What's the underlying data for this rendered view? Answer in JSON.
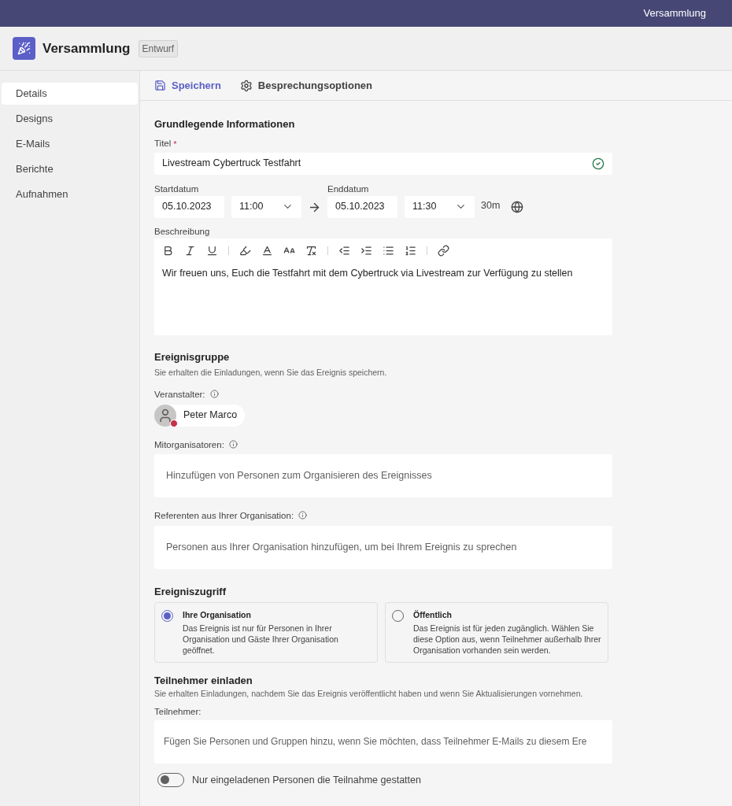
{
  "top_bar": {
    "title": "Versammlung"
  },
  "header": {
    "title": "Versammlung",
    "badge": "Entwurf"
  },
  "sidebar": {
    "items": [
      {
        "label": "Details",
        "selected": true
      },
      {
        "label": "Designs",
        "selected": false
      },
      {
        "label": "E-Mails",
        "selected": false
      },
      {
        "label": "Berichte",
        "selected": false
      },
      {
        "label": "Aufnahmen",
        "selected": false
      }
    ]
  },
  "toolbar": {
    "buttons": [
      {
        "label": "Speichern",
        "kind": "save"
      },
      {
        "label": "Besprechungsoptionen",
        "kind": "options"
      }
    ]
  },
  "basic": {
    "heading": "Grundlegende Informationen",
    "title_label": "Titel",
    "required_mark": "*",
    "title_value": "Livestream Cybertruck Testfahrt",
    "start_label": "Startdatum",
    "start_date": "05.10.2023",
    "start_time": "11:00",
    "end_label": "Enddatum",
    "end_date": "05.10.2023",
    "end_time": "11:30",
    "duration": "30m",
    "description_label": "Beschreibung",
    "description": "Wir freuen uns, Euch die Testfahrt mit dem Cybertruck via Livestream zur Verfügung zu stellen"
  },
  "group": {
    "heading": "Ereignisgruppe",
    "subtitle": "Sie erhalten die Einladungen, wenn Sie das Ereignis speichern.",
    "organizer_label": "Veranstalter:",
    "organizer": {
      "name": "Peter Marco",
      "color": "#c4314b"
    },
    "coorganizers_label": "Mitorganisatoren:",
    "coorganizers_placeholder": "Hinzufügen von Personen zum Organisieren des Ereignisses",
    "presenters_label": "Referenten aus Ihrer Organisation:",
    "presenters_placeholder": "Personen aus Ihrer Organisation hinzufügen, um bei Ihrem Ereignis zu sprechen"
  },
  "access": {
    "heading": "Ereigniszugriff",
    "options": [
      {
        "title": "Ihre Organisation",
        "text": "Das Ereignis ist nur für Personen in Ihrer Organisation und Gäste Ihrer Organisation geöffnet.",
        "selected": true
      },
      {
        "title": "Öffentlich",
        "text": "Das Ereignis ist für jeden zugänglich. Wählen Sie diese Option aus, wenn Teilnehmer außerhalb Ihrer Organisation vorhanden sein werden.",
        "selected": false
      }
    ]
  },
  "invite": {
    "heading": "Teilnehmer einladen",
    "subtitle": "Sie erhalten Einladungen, nachdem Sie das Ereignis veröffentlicht haben und wenn Sie Aktualisierungen vornehmen.",
    "attendees_label": "Teilnehmer:",
    "attendees_placeholder": "Fügen Sie Personen und Gruppen hinzu, wenn Sie möchten, dass Teilnehmer E-Mails zu diesem Ere",
    "toggle": {
      "label": "Nur eingeladenen Personen die Teilnahme gestatten",
      "on": false
    }
  }
}
